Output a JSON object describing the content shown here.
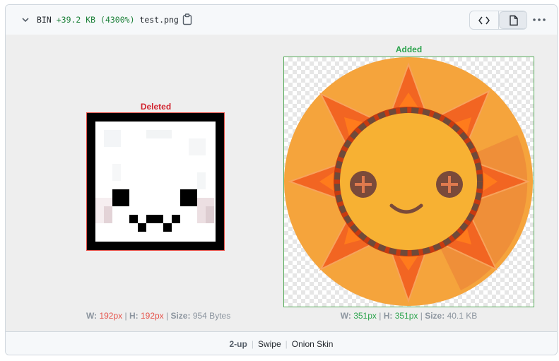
{
  "header": {
    "collapse_icon": "chevron-down-icon",
    "bin_label": "BIN",
    "size_change": "+39.2 KB (4300%)",
    "filename": "test.png",
    "copy_icon": "clipboard-icon",
    "view_buttons": [
      {
        "icon": "code-icon",
        "active": false
      },
      {
        "icon": "file-icon",
        "active": true
      }
    ],
    "more_icon": "kebab-horizontal-icon"
  },
  "deleted": {
    "label": "Deleted",
    "w_label": "W:",
    "w_value": "192px",
    "h_label": "H:",
    "h_value": "192px",
    "size_label": "Size:",
    "size_value": "954 Bytes",
    "color": "#d1242f"
  },
  "added": {
    "label": "Added",
    "w_label": "W:",
    "w_value": "351px",
    "h_label": "H:",
    "h_value": "351px",
    "size_label": "Size:",
    "size_value": "40.1 KB",
    "color": "#2da44e"
  },
  "view_modes": {
    "items": [
      "2-up",
      "Swipe",
      "Onion Skin"
    ],
    "active": "2-up"
  }
}
